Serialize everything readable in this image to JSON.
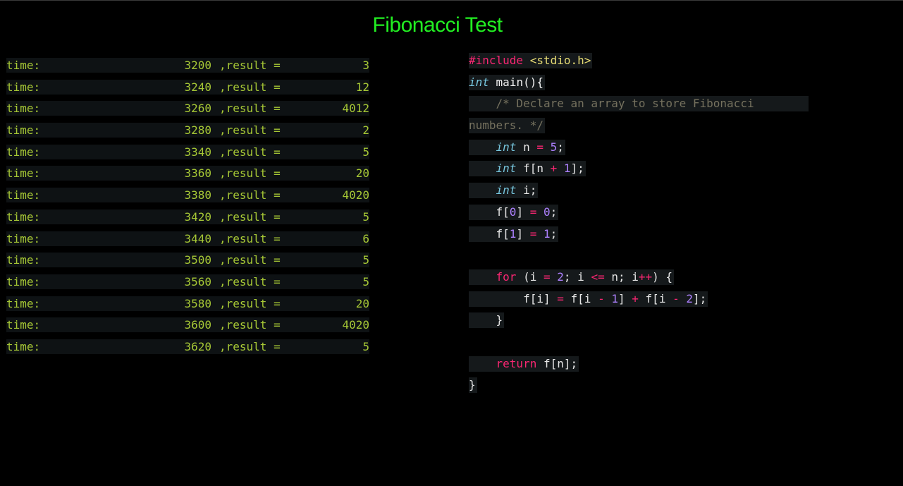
{
  "title": "Fibonacci Test",
  "results": [
    {
      "time_label": "time:",
      "time": "3200",
      "result_label": ",result =",
      "result": "3"
    },
    {
      "time_label": "time:",
      "time": "3240",
      "result_label": ",result =",
      "result": "12"
    },
    {
      "time_label": "time:",
      "time": "3260",
      "result_label": ",result =",
      "result": "4012"
    },
    {
      "time_label": "time:",
      "time": "3280",
      "result_label": ",result =",
      "result": "2"
    },
    {
      "time_label": "time:",
      "time": "3340",
      "result_label": ",result =",
      "result": "5"
    },
    {
      "time_label": "time:",
      "time": "3360",
      "result_label": ",result =",
      "result": "20"
    },
    {
      "time_label": "time:",
      "time": "3380",
      "result_label": ",result =",
      "result": "4020"
    },
    {
      "time_label": "time:",
      "time": "3420",
      "result_label": ",result =",
      "result": "5"
    },
    {
      "time_label": "time:",
      "time": "3440",
      "result_label": ",result =",
      "result": "6"
    },
    {
      "time_label": "time:",
      "time": "3500",
      "result_label": ",result =",
      "result": "5"
    },
    {
      "time_label": "time:",
      "time": "3560",
      "result_label": ",result =",
      "result": "5"
    },
    {
      "time_label": "time:",
      "time": "3580",
      "result_label": ",result =",
      "result": "20"
    },
    {
      "time_label": "time:",
      "time": "3600",
      "result_label": ",result =",
      "result": "4020"
    },
    {
      "time_label": "time:",
      "time": "3620",
      "result_label": ",result =",
      "result": "5"
    }
  ],
  "code": {
    "l1_directive": "#include",
    "l1_header": "<stdio.h>",
    "l2_type": "int",
    "l2_rest": "main(){",
    "l3_comment_a": "/* Declare an array to store Fibonacci",
    "l3_comment_b": "numbers. */",
    "l4_type": "int",
    "l4_a": "n",
    "l4_op": "=",
    "l4_num": "5",
    "l4_end": ";",
    "l5_type": "int",
    "l5_a": "f[n",
    "l5_op": "+",
    "l5_num": "1",
    "l5_end": "];",
    "l6_type": "int",
    "l6_rest": "i;",
    "l7_a": "f[",
    "l7_idx": "0",
    "l7_b": "]",
    "l7_op": "=",
    "l7_num": "0",
    "l7_end": ";",
    "l8_a": "f[",
    "l8_idx": "1",
    "l8_b": "]",
    "l8_op": "=",
    "l8_num": "1",
    "l8_end": ";",
    "l9_kw": "for",
    "l9_a": "(i",
    "l9_op1": "=",
    "l9_n1": "2",
    "l9_b": "; i",
    "l9_op2": "<=",
    "l9_c": "n; i",
    "l9_op3": "++",
    "l9_d": ") {",
    "l10_a": "f[i]",
    "l10_op1": "=",
    "l10_b": "f[i",
    "l10_op2": "-",
    "l10_n1": "1",
    "l10_c": "]",
    "l10_op3": "+",
    "l10_d": "f[i",
    "l10_op4": "-",
    "l10_n2": "2",
    "l10_e": "];",
    "l11": "}",
    "l12_kw": "return",
    "l12_rest": "f[n];",
    "l13": "}"
  },
  "colors": {
    "title": "#22ee22",
    "result_text": "#a6c735",
    "keyword": "#f92672",
    "type": "#78c8e0",
    "string": "#e6db74",
    "number": "#ae81ff",
    "comment": "#75715e"
  }
}
